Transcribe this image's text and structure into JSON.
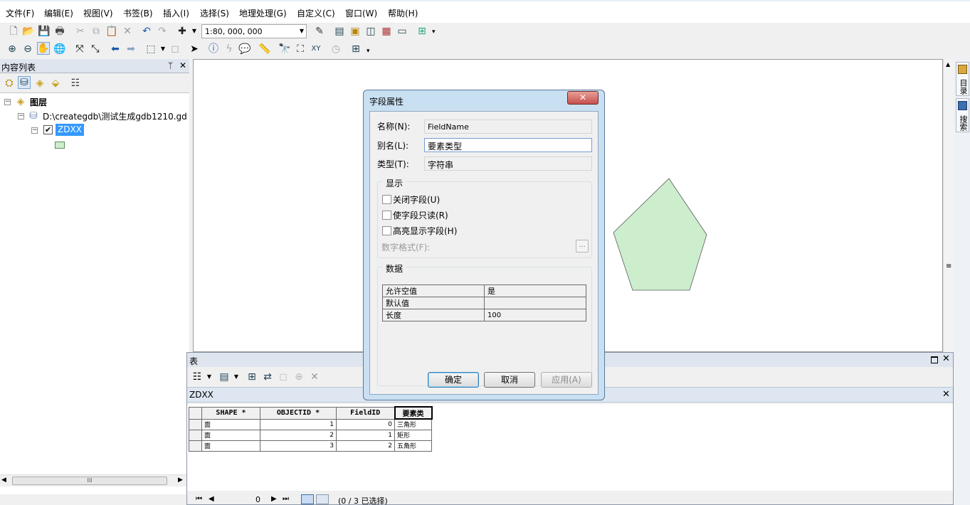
{
  "menu": [
    "文件(F)",
    "编辑(E)",
    "视图(V)",
    "书签(B)",
    "插入(I)",
    "选择(S)",
    "地理处理(G)",
    "自定义(C)",
    "窗口(W)",
    "帮助(H)"
  ],
  "toolbar": {
    "scale": "1:80, 000, 000"
  },
  "toc": {
    "title": "内容列表",
    "pin": "ᛘ",
    "close": "✕",
    "root": "图层",
    "gdb": "D:\\creategdb\\测试生成gdb1210.gd",
    "layer": "ZDXX",
    "hscroll_grip": "III"
  },
  "right_dock": {
    "tab1": "目录",
    "tab2": "搜索"
  },
  "table_window": {
    "title": "表",
    "tab": "ZDXX",
    "columns": [
      "SHAPE *",
      "OBJECTID *",
      "FieldID",
      "要素类"
    ],
    "rows": [
      [
        "面",
        "1",
        "0",
        "三角形"
      ],
      [
        "面",
        "2",
        "1",
        "矩形"
      ],
      [
        "面",
        "3",
        "2",
        "五角形"
      ]
    ],
    "status": "(0 / 3 已选择)",
    "record": "0"
  },
  "dialog": {
    "title": "字段属性",
    "name_label": "名称(N):",
    "name_value": "FieldName",
    "alias_label": "别名(L):",
    "alias_value": "要素类型",
    "type_label": "类型(T):",
    "type_value": "字符串",
    "display_group": "显示",
    "cb_close": "关闭字段(U)",
    "cb_readonly": "使字段只读(R)",
    "cb_highlight": "高亮显示字段(H)",
    "number_format": "数字格式(F):",
    "ellipsis": "...",
    "data_group": "数据",
    "props": [
      [
        "允许空值",
        "是"
      ],
      [
        "默认值",
        ""
      ],
      [
        "长度",
        "100"
      ]
    ],
    "ok": "确定",
    "cancel": "取消",
    "apply": "应用(A)"
  },
  "colors": {
    "polygon_fill": "#cdeecd",
    "selection": "#3399ff",
    "title_bar": "#c9dff2",
    "close_button": "#c75050"
  }
}
